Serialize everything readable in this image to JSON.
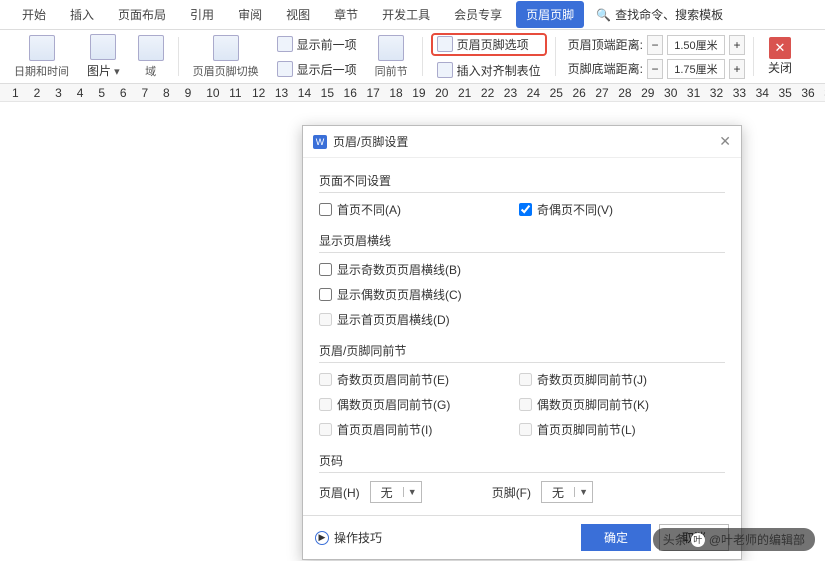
{
  "tabs": {
    "items": [
      "开始",
      "插入",
      "页面布局",
      "引用",
      "审阅",
      "视图",
      "章节",
      "开发工具",
      "会员专享",
      "页眉页脚"
    ],
    "active": 9,
    "search": "查找命令、搜索模板"
  },
  "ribbon": {
    "datetime": "日期和时间",
    "picture": "图片",
    "field": "域",
    "switch": "页眉页脚切换",
    "showPrev": "显示前一项",
    "showNext": "显示后一项",
    "sameSection": "同前节",
    "options": "页眉页脚选项",
    "insertTab": "插入对齐制表位",
    "distTop": {
      "label": "页眉顶端距离:",
      "value": "1.50厘米"
    },
    "distBot": {
      "label": "页脚底端距离:",
      "value": "1.75厘米"
    },
    "close": "关闭"
  },
  "dialog": {
    "title": "页眉/页脚设置",
    "s1": {
      "h": "页面不同设置",
      "firstPage": "首页不同(A)",
      "oddEven": "奇偶页不同(V)"
    },
    "s2": {
      "h": "显示页眉横线",
      "odd": "显示奇数页页眉横线(B)",
      "even": "显示偶数页页眉横线(C)",
      "first": "显示首页页眉横线(D)"
    },
    "s3": {
      "h": "页眉/页脚同前节",
      "a": "奇数页页眉同前节(E)",
      "b": "奇数页页脚同前节(J)",
      "c": "偶数页页眉同前节(G)",
      "d": "偶数页页脚同前节(K)",
      "e": "首页页眉同前节(I)",
      "f": "首页页脚同前节(L)"
    },
    "s4": {
      "h": "页码",
      "headerL": "页眉(H)",
      "footerL": "页脚(F)",
      "none": "无"
    },
    "tips": "操作技巧",
    "ok": "确定",
    "cancel": "取消"
  },
  "watermark": {
    "brand": "头条",
    "author": "@叶老师的编辑部"
  }
}
